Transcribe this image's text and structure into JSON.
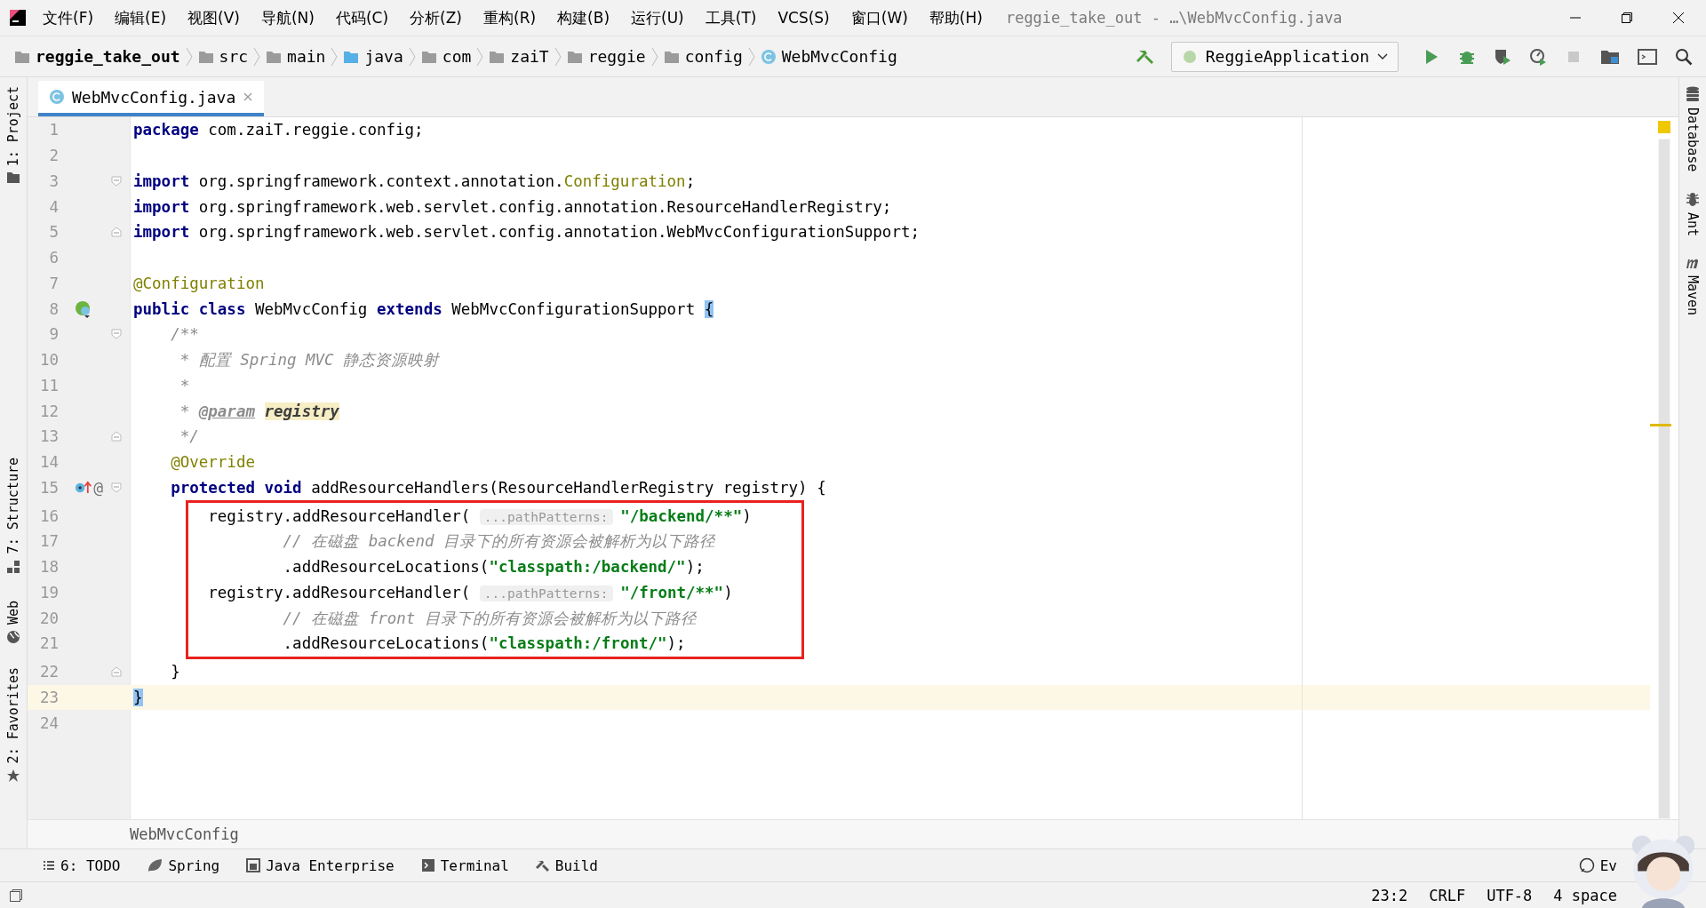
{
  "menu": {
    "items": [
      "文件(F)",
      "编辑(E)",
      "视图(V)",
      "导航(N)",
      "代码(C)",
      "分析(Z)",
      "重构(R)",
      "构建(B)",
      "运行(U)",
      "工具(T)",
      "VCS(S)",
      "窗口(W)",
      "帮助(H)"
    ],
    "title": "reggie_take_out - …\\WebMvcConfig.java"
  },
  "breadcrumbs": [
    {
      "kind": "project",
      "label": "reggie_take_out"
    },
    {
      "kind": "folder",
      "label": "src"
    },
    {
      "kind": "folder",
      "label": "main"
    },
    {
      "kind": "source",
      "label": "java"
    },
    {
      "kind": "folder",
      "label": "com"
    },
    {
      "kind": "folder",
      "label": "zaiT"
    },
    {
      "kind": "folder",
      "label": "reggie"
    },
    {
      "kind": "folder",
      "label": "config"
    },
    {
      "kind": "class",
      "label": "WebMvcConfig"
    }
  ],
  "run_config": "ReggieApplication",
  "tabs": [
    {
      "label": "WebMvcConfig.java",
      "selected": true
    }
  ],
  "left_tools": [
    {
      "kind": "folder",
      "label": "1: Project"
    },
    {
      "kind": "structure",
      "label": "7: Structure"
    },
    {
      "kind": "web",
      "label": "Web"
    },
    {
      "kind": "star",
      "label": "2: Favorites"
    }
  ],
  "right_tools": [
    {
      "kind": "database",
      "label": "Database"
    },
    {
      "kind": "ant",
      "label": "Ant"
    },
    {
      "kind": "maven",
      "label": "Maven"
    }
  ],
  "blocks": [
    {
      "boxed": false,
      "lines": [
        {
          "number": "1",
          "fold_start": false,
          "fold_end": false,
          "bean": false,
          "override": false,
          "current": false,
          "tokens": [
            {
              "kind": "keyword",
              "text": "package"
            },
            {
              "kind": "plain",
              "text": " com.zaiT.reggie.config;"
            }
          ]
        },
        {
          "number": "2",
          "fold_start": false,
          "fold_end": false,
          "bean": false,
          "override": false,
          "current": false
        },
        {
          "number": "3",
          "fold_start": true,
          "fold_end": false,
          "bean": false,
          "override": false,
          "current": false,
          "tokens": [
            {
              "kind": "keyword",
              "text": "import"
            },
            {
              "kind": "plain",
              "text": " org.springframework.context.annotation."
            },
            {
              "kind": "annotation",
              "text": "Configuration"
            },
            {
              "kind": "plain",
              "text": ";"
            }
          ]
        },
        {
          "number": "4",
          "fold_start": false,
          "fold_end": false,
          "bean": false,
          "override": false,
          "current": false,
          "tokens": [
            {
              "kind": "keyword",
              "text": "import"
            },
            {
              "kind": "plain",
              "text": " org.springframework.web.servlet.config.annotation.ResourceHandlerRegistry;"
            }
          ]
        },
        {
          "number": "5",
          "fold_start": false,
          "fold_end": true,
          "bean": false,
          "override": false,
          "current": false,
          "tokens": [
            {
              "kind": "keyword",
              "text": "import"
            },
            {
              "kind": "plain",
              "text": " org.springframework.web.servlet.config.annotation.WebMvcConfigurationSupport;"
            }
          ]
        },
        {
          "number": "6",
          "fold_start": false,
          "fold_end": false,
          "bean": false,
          "override": false,
          "current": false
        },
        {
          "number": "7",
          "fold_start": false,
          "fold_end": false,
          "bean": false,
          "override": false,
          "current": false,
          "tokens": [
            {
              "kind": "annotation",
              "text": "@Configuration"
            }
          ]
        },
        {
          "number": "8",
          "fold_start": false,
          "fold_end": false,
          "bean": true,
          "override": false,
          "current": false,
          "tokens": [
            {
              "kind": "keyword",
              "text": "public class"
            },
            {
              "kind": "plain",
              "text": " WebMvcConfig "
            },
            {
              "kind": "keyword",
              "text": "extends"
            },
            {
              "kind": "plain",
              "text": " WebMvcConfigurationSupport "
            },
            {
              "kind": "brace",
              "text": "{"
            }
          ]
        },
        {
          "number": "9",
          "fold_start": true,
          "fold_end": false,
          "bean": false,
          "override": false,
          "current": false,
          "tokens": [
            {
              "kind": "comment",
              "text": "    /**"
            }
          ]
        },
        {
          "number": "10",
          "fold_start": false,
          "fold_end": false,
          "bean": false,
          "override": false,
          "current": false,
          "tokens": [
            {
              "kind": "comment",
              "text": "     * 配置 Spring MVC 静态资源映射"
            }
          ]
        },
        {
          "number": "11",
          "fold_start": false,
          "fold_end": false,
          "bean": false,
          "override": false,
          "current": false,
          "tokens": [
            {
              "kind": "comment",
              "text": "     *"
            }
          ]
        },
        {
          "number": "12",
          "fold_start": false,
          "fold_end": false,
          "bean": false,
          "override": false,
          "current": false,
          "tokens": [
            {
              "kind": "comment",
              "text": "     * "
            },
            {
              "kind": "doc-tag",
              "text": "@param"
            },
            {
              "kind": "doc-param",
              "text": "registry"
            }
          ]
        },
        {
          "number": "13",
          "fold_start": false,
          "fold_end": true,
          "bean": false,
          "override": false,
          "current": false,
          "tokens": [
            {
              "kind": "comment",
              "text": "     */"
            }
          ]
        },
        {
          "number": "14",
          "fold_start": false,
          "fold_end": false,
          "bean": false,
          "override": false,
          "current": false,
          "tokens": [
            {
              "kind": "annotation",
              "text": "    @Override"
            }
          ]
        },
        {
          "number": "15",
          "fold_start": true,
          "fold_end": false,
          "bean": false,
          "override": true,
          "gutter_text": "@",
          "current": false,
          "tokens": [
            {
              "kind": "keyword",
              "text": "    protected void"
            },
            {
              "kind": "plain",
              "text": " addResourceHandlers(ResourceHandlerRegistry registry) {"
            }
          ]
        }
      ]
    },
    {
      "boxed": true,
      "lines": [
        {
          "number": "16",
          "fold_start": false,
          "fold_end": false,
          "bean": false,
          "override": false,
          "current": false,
          "tokens": [
            {
              "kind": "plain",
              "text": "        registry.addResourceHandler( "
            },
            {
              "kind": "hint",
              "text": "...pathPatterns:"
            },
            {
              "kind": "string",
              "text": "\"/backend/**\""
            },
            {
              "kind": "plain",
              "text": ")"
            }
          ]
        },
        {
          "number": "17",
          "fold_start": false,
          "fold_end": false,
          "bean": false,
          "override": false,
          "current": false,
          "tokens": [
            {
              "kind": "comment",
              "text": "                // 在磁盘 backend 目录下的所有资源会被解析为以下路径"
            }
          ]
        },
        {
          "number": "18",
          "fold_start": false,
          "fold_end": false,
          "bean": false,
          "override": false,
          "current": false,
          "tokens": [
            {
              "kind": "plain",
              "text": "                .addResourceLocations("
            },
            {
              "kind": "string",
              "text": "\"classpath:/backend/\""
            },
            {
              "kind": "plain",
              "text": ");"
            }
          ]
        },
        {
          "number": "19",
          "fold_start": false,
          "fold_end": false,
          "bean": false,
          "override": false,
          "current": false,
          "tokens": [
            {
              "kind": "plain",
              "text": "        registry.addResourceHandler( "
            },
            {
              "kind": "hint",
              "text": "...pathPatterns:"
            },
            {
              "kind": "string",
              "text": "\"/front/**\""
            },
            {
              "kind": "plain",
              "text": ")"
            }
          ]
        },
        {
          "number": "20",
          "fold_start": false,
          "fold_end": false,
          "bean": false,
          "override": false,
          "current": false,
          "tokens": [
            {
              "kind": "comment",
              "text": "                // 在磁盘 front 目录下的所有资源会被解析为以下路径"
            }
          ]
        },
        {
          "number": "21",
          "fold_start": false,
          "fold_end": false,
          "bean": false,
          "override": false,
          "current": false,
          "tokens": [
            {
              "kind": "plain",
              "text": "                .addResourceLocations("
            },
            {
              "kind": "string",
              "text": "\"classpath:/front/\""
            },
            {
              "kind": "plain",
              "text": ");"
            }
          ]
        }
      ]
    },
    {
      "boxed": false,
      "lines": [
        {
          "number": "22",
          "fold_start": false,
          "fold_end": true,
          "bean": false,
          "override": false,
          "current": false,
          "tokens": [
            {
              "kind": "plain",
              "text": "    }"
            }
          ]
        },
        {
          "number": "23",
          "fold_start": false,
          "fold_end": false,
          "bean": false,
          "override": false,
          "current": true,
          "tokens": [
            {
              "kind": "brace",
              "text": "}"
            }
          ]
        },
        {
          "number": "24",
          "fold_start": false,
          "fold_end": false,
          "bean": false,
          "override": false,
          "current": false
        }
      ]
    }
  ],
  "editor_breadcrumb": "WebMvcConfig",
  "bottom_tools": [
    {
      "kind": "list",
      "label": "6: TODO"
    },
    {
      "kind": "leaf",
      "label": "Spring"
    },
    {
      "kind": "enterprise",
      "label": "Java Enterprise"
    },
    {
      "kind": "terminal",
      "label": "Terminal"
    },
    {
      "kind": "hammer",
      "label": "Build"
    },
    {
      "kind": "event",
      "label": "Ev"
    }
  ],
  "status": [
    "23:2",
    "CRLF",
    "UTF-8",
    "4 space"
  ]
}
